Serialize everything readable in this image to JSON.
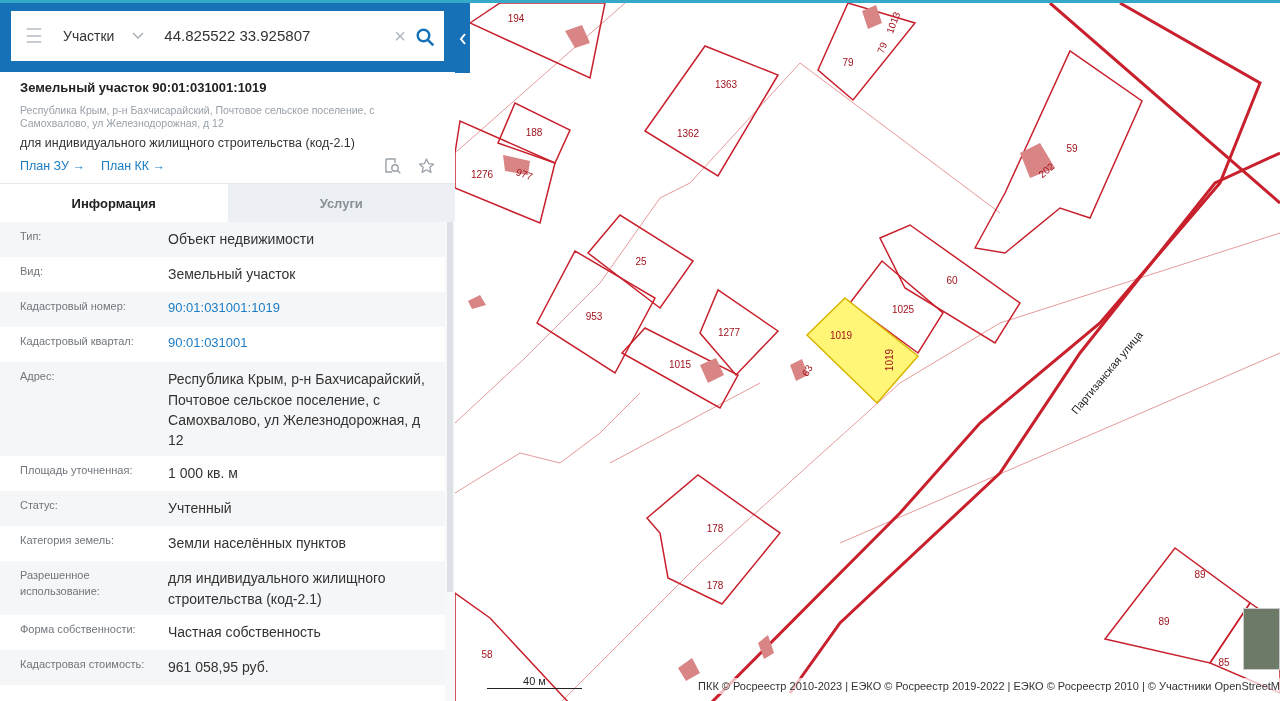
{
  "search": {
    "menu": "☰",
    "category": "Участки",
    "value": "44.825522 33.925807",
    "clear": "×"
  },
  "object": {
    "title": "Земельный участок 90:01:031001:1019",
    "address": "Республика Крым, р-н Бахчисарайский, Почтовое сельское поселение, с Самохвалово, ул Железнодорожная, д 12",
    "purpose": "для индивидуального жилищного строительства (код-2.1)",
    "links": [
      "План ЗУ →",
      "План КК →"
    ],
    "favorite": false
  },
  "tabs": [
    {
      "label": "Информация",
      "selected": true
    },
    {
      "label": "Услуги",
      "selected": false
    }
  ],
  "rows": [
    {
      "label": "Тип:",
      "value": "Объект недвижимости",
      "kind": "text"
    },
    {
      "label": "Вид:",
      "value": "Земельный участок",
      "kind": "text"
    },
    {
      "label": "Кадастровый номер:",
      "value": "90:01:031001:1019",
      "kind": "link"
    },
    {
      "label": "Кадастровый квартал:",
      "value": "90:01:031001",
      "kind": "link"
    },
    {
      "label": "Адрес:",
      "value": "Республика Крым, р-н Бахчисарайский, Почтовое сельское поселение, с Самохвалово, ул Железнодорожная, д 12",
      "kind": "text"
    },
    {
      "label": "Площадь уточненная:",
      "value": "1 000 кв. м",
      "kind": "text"
    },
    {
      "label": "Статус:",
      "value": "Учтенный",
      "kind": "text"
    },
    {
      "label": "Категория земель:",
      "value": "Земли населённых пунктов",
      "kind": "text"
    },
    {
      "label": "Разрешенное использование:",
      "value": "для индивидуального жилищного строительства (код-2.1)",
      "kind": "text"
    },
    {
      "label": "Форма собственности:",
      "value": "Частная собственность",
      "kind": "text"
    },
    {
      "label": "Кадастровая стоимость:",
      "value": "961 058,95 руб.",
      "kind": "text"
    }
  ],
  "map": {
    "labels": [
      "194",
      "1363",
      "79",
      "79",
      "1013",
      "188",
      "1362",
      "1276",
      "977",
      "59",
      "202",
      "25",
      "953",
      "1277",
      "1015",
      "60",
      "1025",
      "1019",
      "1019",
      "63",
      "178",
      "178",
      "58",
      "89",
      "89",
      "85"
    ],
    "street": "Партизанская улица",
    "scale": "40 м",
    "attribution": "ПКК © Росреестр 2010-2023 | ЕЭКО © Росреестр 2019-2022 | ЕЭКО © Росреестр 2010 | © Участники OpenStreetM"
  }
}
